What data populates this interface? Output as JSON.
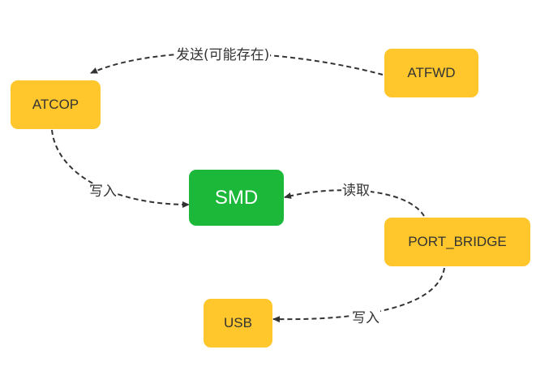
{
  "nodes": {
    "atcop": {
      "label": "ATCOP",
      "color": "#FFC72C"
    },
    "atfwd": {
      "label": "ATFWD",
      "color": "#FFC72C"
    },
    "smd": {
      "label": "SMD",
      "color": "#1BB83A"
    },
    "port_bridge": {
      "label": "PORT_BRIDGE",
      "color": "#FFC72C"
    },
    "usb": {
      "label": "USB",
      "color": "#FFC72C"
    }
  },
  "edges": {
    "atfwd_to_atcop": {
      "label": "发送(可能存在)"
    },
    "atcop_to_smd": {
      "label": "写入"
    },
    "port_bridge_to_smd": {
      "label": "读取"
    },
    "port_bridge_to_usb": {
      "label": "写入"
    }
  }
}
